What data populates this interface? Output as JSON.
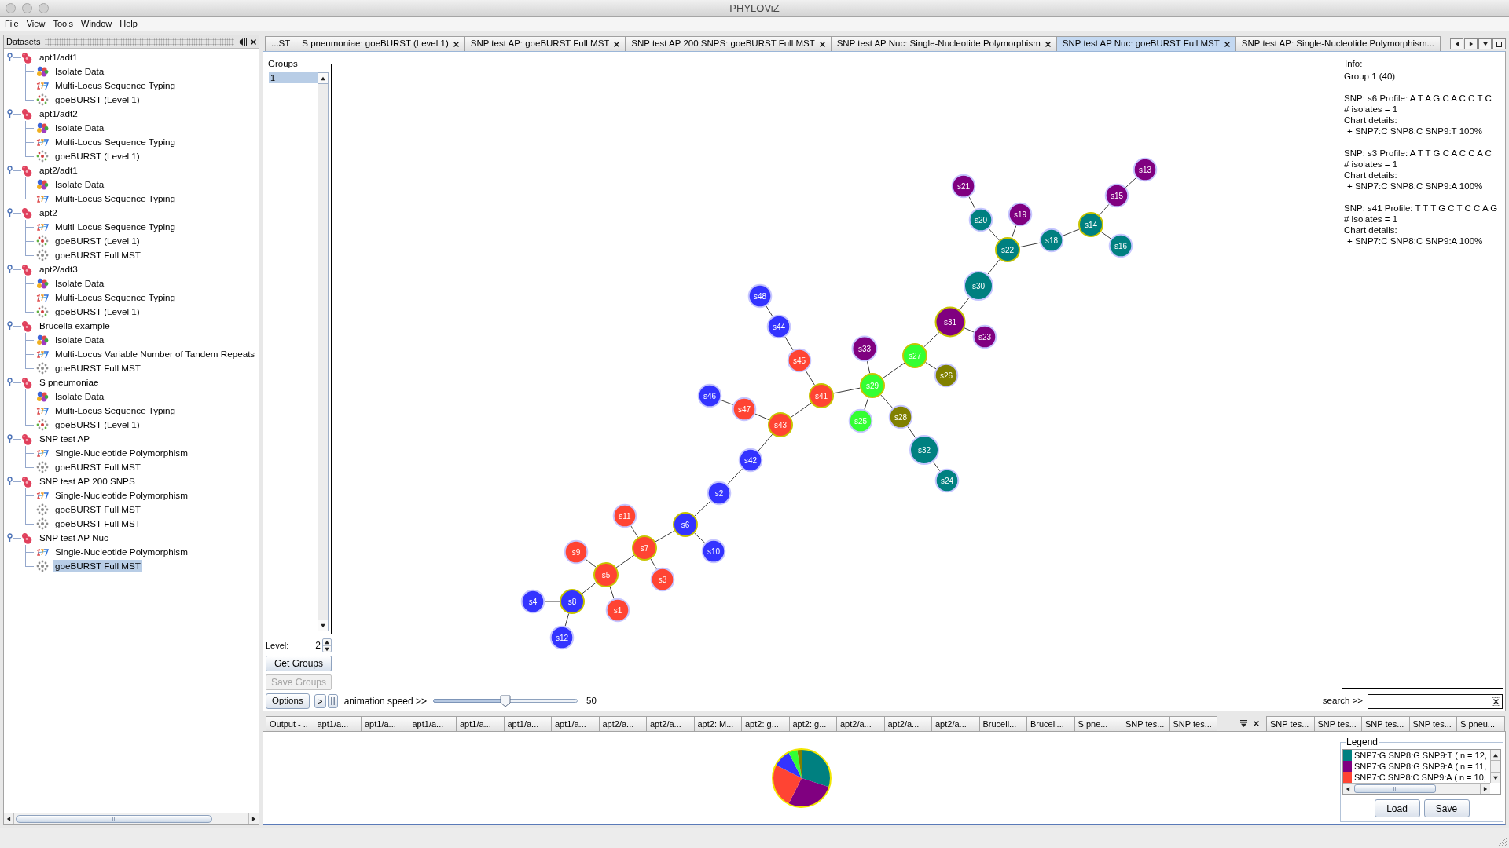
{
  "window": {
    "title": "PHYLOViZ"
  },
  "menu": [
    "File",
    "View",
    "Tools",
    "Window",
    "Help"
  ],
  "datasets_panel": {
    "title": "Datasets",
    "tree": [
      {
        "label": "apt1/adt1",
        "expanded": true,
        "selected": false,
        "children": [
          {
            "label": "Isolate Data",
            "kind": "isolate",
            "selected": false
          },
          {
            "label": "Multi-Locus Sequence Typing",
            "kind": "typing",
            "selected": false
          },
          {
            "label": "goeBURST (Level 1)",
            "kind": "goeburst_level",
            "selected": false
          }
        ]
      },
      {
        "label": "apt1/adt2",
        "expanded": true,
        "selected": false,
        "children": [
          {
            "label": "Isolate Data",
            "kind": "isolate",
            "selected": false
          },
          {
            "label": "Multi-Locus Sequence Typing",
            "kind": "typing",
            "selected": false
          },
          {
            "label": "goeBURST (Level 1)",
            "kind": "goeburst_level",
            "selected": false
          }
        ]
      },
      {
        "label": "apt2/adt1",
        "expanded": true,
        "selected": false,
        "children": [
          {
            "label": "Isolate Data",
            "kind": "isolate",
            "selected": false
          },
          {
            "label": "Multi-Locus Sequence Typing",
            "kind": "typing",
            "selected": false
          }
        ]
      },
      {
        "label": "apt2",
        "expanded": true,
        "selected": false,
        "children": [
          {
            "label": "Multi-Locus Sequence Typing",
            "kind": "typing",
            "selected": false
          },
          {
            "label": "goeBURST (Level 1)",
            "kind": "goeburst_level",
            "selected": false
          },
          {
            "label": "goeBURST Full MST",
            "kind": "goeburst_mst",
            "selected": false
          }
        ]
      },
      {
        "label": "apt2/adt3",
        "expanded": true,
        "selected": false,
        "children": [
          {
            "label": "Isolate Data",
            "kind": "isolate",
            "selected": false
          },
          {
            "label": "Multi-Locus Sequence Typing",
            "kind": "typing",
            "selected": false
          },
          {
            "label": "goeBURST (Level 1)",
            "kind": "goeburst_level",
            "selected": false
          }
        ]
      },
      {
        "label": "Brucella example",
        "expanded": true,
        "selected": false,
        "children": [
          {
            "label": "Isolate Data",
            "kind": "isolate",
            "selected": false
          },
          {
            "label": "Multi-Locus Variable Number of Tandem Repeats",
            "kind": "typing",
            "selected": false
          },
          {
            "label": "goeBURST Full MST",
            "kind": "goeburst_mst",
            "selected": false
          }
        ]
      },
      {
        "label": "S pneumoniae",
        "expanded": true,
        "selected": false,
        "children": [
          {
            "label": "Isolate Data",
            "kind": "isolate",
            "selected": false
          },
          {
            "label": "Multi-Locus Sequence Typing",
            "kind": "typing",
            "selected": false
          },
          {
            "label": "goeBURST (Level 1)",
            "kind": "goeburst_level",
            "selected": false
          }
        ]
      },
      {
        "label": "SNP test AP",
        "expanded": true,
        "selected": false,
        "children": [
          {
            "label": "Single-Nucleotide Polymorphism",
            "kind": "typing",
            "selected": false
          },
          {
            "label": "goeBURST Full MST",
            "kind": "goeburst_mst",
            "selected": false
          }
        ]
      },
      {
        "label": "SNP test AP 200 SNPS",
        "expanded": true,
        "selected": false,
        "children": [
          {
            "label": "Single-Nucleotide Polymorphism",
            "kind": "typing",
            "selected": false
          },
          {
            "label": "goeBURST Full MST",
            "kind": "goeburst_mst",
            "selected": false
          },
          {
            "label": "goeBURST Full MST",
            "kind": "goeburst_mst",
            "selected": false
          }
        ]
      },
      {
        "label": "SNP test AP Nuc",
        "expanded": true,
        "selected": false,
        "children": [
          {
            "label": "Single-Nucleotide Polymorphism",
            "kind": "typing",
            "selected": false
          },
          {
            "label": "goeBURST Full MST",
            "kind": "goeburst_mst",
            "selected": true
          }
        ]
      }
    ]
  },
  "tabs": [
    {
      "label": "...ST",
      "closable": false,
      "selected": false
    },
    {
      "label": "S pneumoniae: goeBURST (Level 1)",
      "closable": true,
      "selected": false
    },
    {
      "label": "SNP test AP: goeBURST Full MST",
      "closable": true,
      "selected": false
    },
    {
      "label": "SNP test AP 200 SNPS: goeBURST Full MST",
      "closable": true,
      "selected": false
    },
    {
      "label": "SNP test AP Nuc: Single-Nucleotide Polymorphism",
      "closable": true,
      "selected": false
    },
    {
      "label": "SNP test AP Nuc: goeBURST Full MST",
      "closable": true,
      "selected": true
    },
    {
      "label": "SNP test AP: Single-Nucleotide Polymorphism...",
      "closable": false,
      "selected": false
    }
  ],
  "groups": {
    "title": "Groups",
    "items": [
      {
        "label": "1",
        "selected": true
      }
    ],
    "level_label": "Level:",
    "level_value": "2",
    "buttons": [
      {
        "label": "Get Groups",
        "disabled": false
      },
      {
        "label": "Save Groups",
        "disabled": true
      }
    ]
  },
  "graph": {
    "root": {
      "label": "s29",
      "color": "#33ff33",
      "highlighted": true,
      "children": [
        {
          "label": "s27",
          "color": "#33ff33",
          "highlighted": true,
          "children": [
            {
              "label": "s31",
              "color": "#800080",
              "highlighted": true,
              "children": [
                {
                  "label": "s30",
                  "color": "#008080",
                  "highlighted": false,
                  "children": [
                    {
                      "label": "s22",
                      "color": "#008080",
                      "highlighted": true,
                      "children": [
                        {
                          "label": "s20",
                          "color": "#008080",
                          "highlighted": false,
                          "children": [
                            {
                              "label": "s21",
                              "color": "#800080",
                              "highlighted": false
                            }
                          ]
                        },
                        {
                          "label": "s19",
                          "color": "#800080",
                          "highlighted": false
                        },
                        {
                          "label": "s18",
                          "color": "#008080",
                          "highlighted": false,
                          "children": [
                            {
                              "label": "s14",
                              "color": "#008080",
                              "highlighted": true,
                              "children": [
                                {
                                  "label": "s15",
                                  "color": "#800080",
                                  "highlighted": false,
                                  "children": [
                                    {
                                      "label": "s13",
                                      "color": "#800080",
                                      "highlighted": false
                                    }
                                  ]
                                },
                                {
                                  "label": "s16",
                                  "color": "#008080",
                                  "highlighted": false
                                }
                              ]
                            }
                          ]
                        }
                      ]
                    }
                  ]
                },
                {
                  "label": "s23",
                  "color": "#800080",
                  "highlighted": false
                }
              ]
            },
            {
              "label": "s26",
              "color": "#808000",
              "highlighted": false
            }
          ]
        },
        {
          "label": "s33",
          "color": "#800080",
          "highlighted": false
        },
        {
          "label": "s25",
          "color": "#33ff33",
          "highlighted": false
        },
        {
          "label": "s28",
          "color": "#808000",
          "highlighted": false,
          "children": [
            {
              "label": "s32",
              "color": "#008080",
              "highlighted": false,
              "children": [
                {
                  "label": "s24",
                  "color": "#008080",
                  "highlighted": false
                }
              ]
            }
          ]
        },
        {
          "label": "s41",
          "color": "#ff4433",
          "highlighted": true,
          "children": [
            {
              "label": "s45",
              "color": "#ff4433",
              "highlighted": false,
              "children": [
                {
                  "label": "s44",
                  "color": "#3333ff",
                  "highlighted": false,
                  "children": [
                    {
                      "label": "s48",
                      "color": "#3333ff",
                      "highlighted": false
                    }
                  ]
                }
              ]
            },
            {
              "label": "s43",
              "color": "#ff4433",
              "highlighted": true,
              "children": [
                {
                  "label": "s47",
                  "color": "#ff4433",
                  "highlighted": false,
                  "children": [
                    {
                      "label": "s46",
                      "color": "#3333ff",
                      "highlighted": false
                    }
                  ]
                },
                {
                  "label": "s42",
                  "color": "#3333ff",
                  "highlighted": false,
                  "children": [
                    {
                      "label": "s2",
                      "color": "#3333ff",
                      "highlighted": false,
                      "children": [
                        {
                          "label": "s6",
                          "color": "#3333ff",
                          "highlighted": true,
                          "children": [
                            {
                              "label": "s10",
                              "color": "#3333ff",
                              "highlighted": false
                            },
                            {
                              "label": "s7",
                              "color": "#ff4433",
                              "highlighted": true,
                              "children": [
                                {
                                  "label": "s11",
                                  "color": "#ff4433",
                                  "highlighted": false
                                },
                                {
                                  "label": "s3",
                                  "color": "#ff4433",
                                  "highlighted": false
                                },
                                {
                                  "label": "s5",
                                  "color": "#ff4433",
                                  "highlighted": true,
                                  "children": [
                                    {
                                      "label": "s9",
                                      "color": "#ff4433",
                                      "highlighted": false
                                    },
                                    {
                                      "label": "s1",
                                      "color": "#ff4433",
                                      "highlighted": false
                                    },
                                    {
                                      "label": "s8",
                                      "color": "#3333ff",
                                      "highlighted": true,
                                      "children": [
                                        {
                                          "label": "s4",
                                          "color": "#3333ff",
                                          "highlighted": false
                                        },
                                        {
                                          "label": "s12",
                                          "color": "#3333ff",
                                          "highlighted": false
                                        }
                                      ]
                                    }
                                  ]
                                }
                              ]
                            }
                          ]
                        }
                      ]
                    }
                  ]
                }
              ]
            }
          ]
        }
      ]
    }
  },
  "info": {
    "title": "Info:",
    "group": "Group 1 (40)",
    "entries": [
      {
        "profile": "SNP: s6 Profile: A T A G C A C C T C",
        "isolates": "# isolates = 1",
        "chart_label": "Chart details:",
        "chart_detail": "+ SNP7:C SNP8:C SNP9:T 100%"
      },
      {
        "profile": "SNP: s3 Profile: A T T G C A C C A C",
        "isolates": "# isolates = 1",
        "chart_label": "Chart details:",
        "chart_detail": "+ SNP7:C SNP8:C SNP9:A 100%"
      },
      {
        "profile": "SNP: s41 Profile: T T T G C T C C A G",
        "isolates": "# isolates = 1",
        "chart_label": "Chart details:",
        "chart_detail": "+ SNP7:C SNP8:C SNP9:A 100%"
      }
    ]
  },
  "controls": {
    "options_button": "Options",
    "play_button": ">",
    "speed_label": "animation speed >>",
    "speed_slider": {
      "level": 0.5,
      "reading": "50"
    },
    "search_label": "search >>"
  },
  "bottom_tabs": {
    "row": [
      "Output - ..",
      "apt1/a...",
      "apt1/a...",
      "apt1/a...",
      "apt1/a...",
      "apt1/a...",
      "apt1/a...",
      "apt2/a...",
      "apt2/a...",
      "apt2: M...",
      "apt2: g...",
      "apt2: g...",
      "apt2/a...",
      "apt2/a...",
      "apt2/a...",
      "Brucell...",
      "Brucell...",
      "S pne...",
      "SNP tes...",
      "SNP tes..."
    ],
    "after_controls": [
      "SNP tes...",
      "SNP tes...",
      "SNP tes...",
      "SNP tes...",
      "S pneu..."
    ]
  },
  "legend": {
    "title": "Legend",
    "items": [
      {
        "label": "SNP7:G SNP8:G SNP9:T ( n = 12,",
        "color": "#008080"
      },
      {
        "label": "SNP7:G SNP8:G SNP9:A ( n = 11,",
        "color": "#800080"
      },
      {
        "label": "SNP7:C SNP8:C SNP9:A ( n = 10,",
        "color": "#ff4433"
      }
    ],
    "buttons": [
      "Load",
      "Save"
    ]
  }
}
